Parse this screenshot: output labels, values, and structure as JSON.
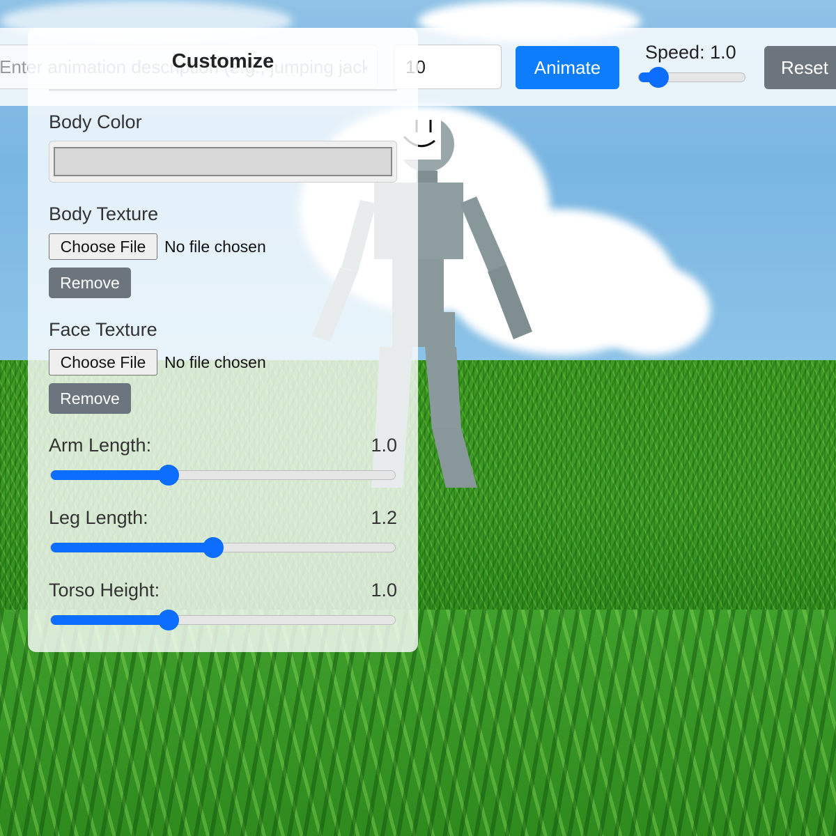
{
  "toolbar": {
    "animation_input": {
      "placeholder": "Enter animation description (e.g., jumping jacks)",
      "value": ""
    },
    "duration_value": "10",
    "animate_label": "Animate",
    "speed_label": "Speed: 1.0",
    "speed_value": 1.0,
    "reset_label": "Reset"
  },
  "panel": {
    "title": "Customize",
    "body_color": {
      "label": "Body Color",
      "value": "#d8d8d8"
    },
    "body_texture": {
      "label": "Body Texture",
      "file_button": "Choose File",
      "file_status": "No file chosen",
      "remove_label": "Remove"
    },
    "face_texture": {
      "label": "Face Texture",
      "file_button": "Choose File",
      "file_status": "No file chosen",
      "remove_label": "Remove"
    },
    "arm_length": {
      "label": "Arm Length:",
      "value": "1.0",
      "fraction": 0.34
    },
    "leg_length": {
      "label": "Leg Length:",
      "value": "1.2",
      "fraction": 0.47
    },
    "torso_height": {
      "label": "Torso Height:",
      "value": "1.0",
      "fraction": 0.34
    }
  },
  "colors": {
    "primary": "#0d7dfb",
    "secondary": "#6c757d",
    "sky": "#79b6e2",
    "grass": "#3a9a26",
    "character": "#8fa0a3"
  }
}
